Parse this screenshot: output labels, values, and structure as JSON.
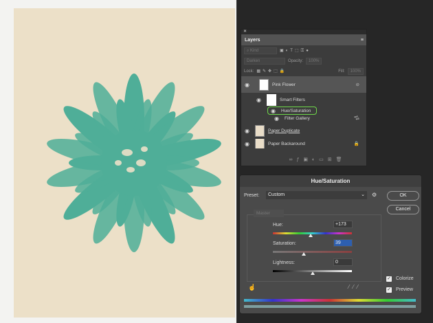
{
  "layers_panel": {
    "title": "Layers",
    "kind_placeholder": "Kind",
    "blend_mode": "Darken",
    "opacity_label": "Opacity:",
    "opacity_value": "100%",
    "lock_label": "Lock:",
    "fill_label": "Fill:",
    "fill_value": "100%",
    "layers": [
      {
        "name": "Pink Flower"
      },
      {
        "name": "Smart Filters"
      },
      {
        "name": "Hue/Saturation"
      },
      {
        "name": "Filter Gallery"
      },
      {
        "name": "Paper Duplicate"
      },
      {
        "name": "Paper Backaround"
      }
    ]
  },
  "dialog": {
    "title": "Hue/Saturation",
    "preset_label": "Preset:",
    "preset_value": "Custom",
    "ok": "OK",
    "cancel": "Cancel",
    "channel": "Master",
    "hue_label": "Hue:",
    "hue_value": "+173",
    "hue_fraction": 0.48,
    "sat_label": "Saturation:",
    "sat_value": "39",
    "sat_fraction": 0.39,
    "light_label": "Lightness:",
    "light_value": "0",
    "light_fraction": 0.5,
    "colorize_label": "Colorize",
    "colorize_checked": true,
    "preview_label": "Preview",
    "preview_checked": true
  },
  "colors": {
    "flower": "#4fae98",
    "paper": "#ece0c8",
    "highlight": "#6fd94a"
  }
}
